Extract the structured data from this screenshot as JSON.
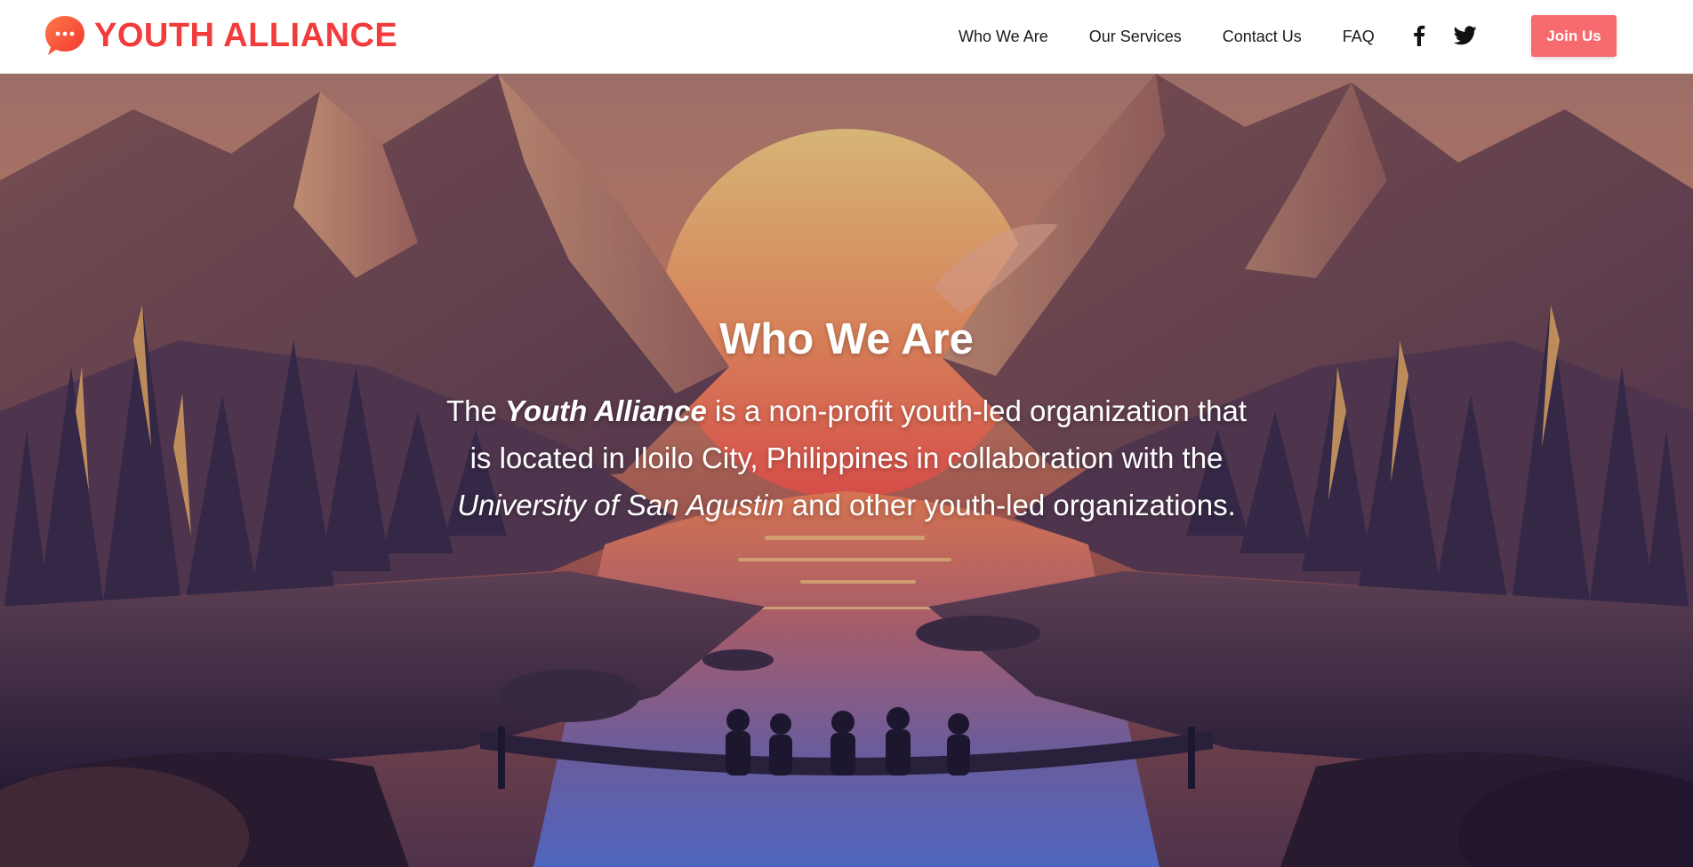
{
  "brand": {
    "name": "YOUTH ALLIANCE",
    "color": "#f23b3b",
    "logo_icon": "chat-bubble-icon"
  },
  "nav": {
    "links": [
      "Who We Are",
      "Our Services",
      "Contact Us",
      "FAQ"
    ],
    "social": [
      "facebook-icon",
      "twitter-icon"
    ],
    "join_label": "Join Us",
    "join_color": "#f76b6e"
  },
  "hero": {
    "title": "Who We Are",
    "text_1": "The ",
    "text_org": "Youth Alliance",
    "text_2": " is a non-profit youth-led organization that is located in Iloilo City, Philippines in collaboration with the ",
    "text_univ": "University of San Agustin",
    "text_3": " and other youth-led organizations.",
    "background": "sunset-mountain-lake-illustration"
  }
}
